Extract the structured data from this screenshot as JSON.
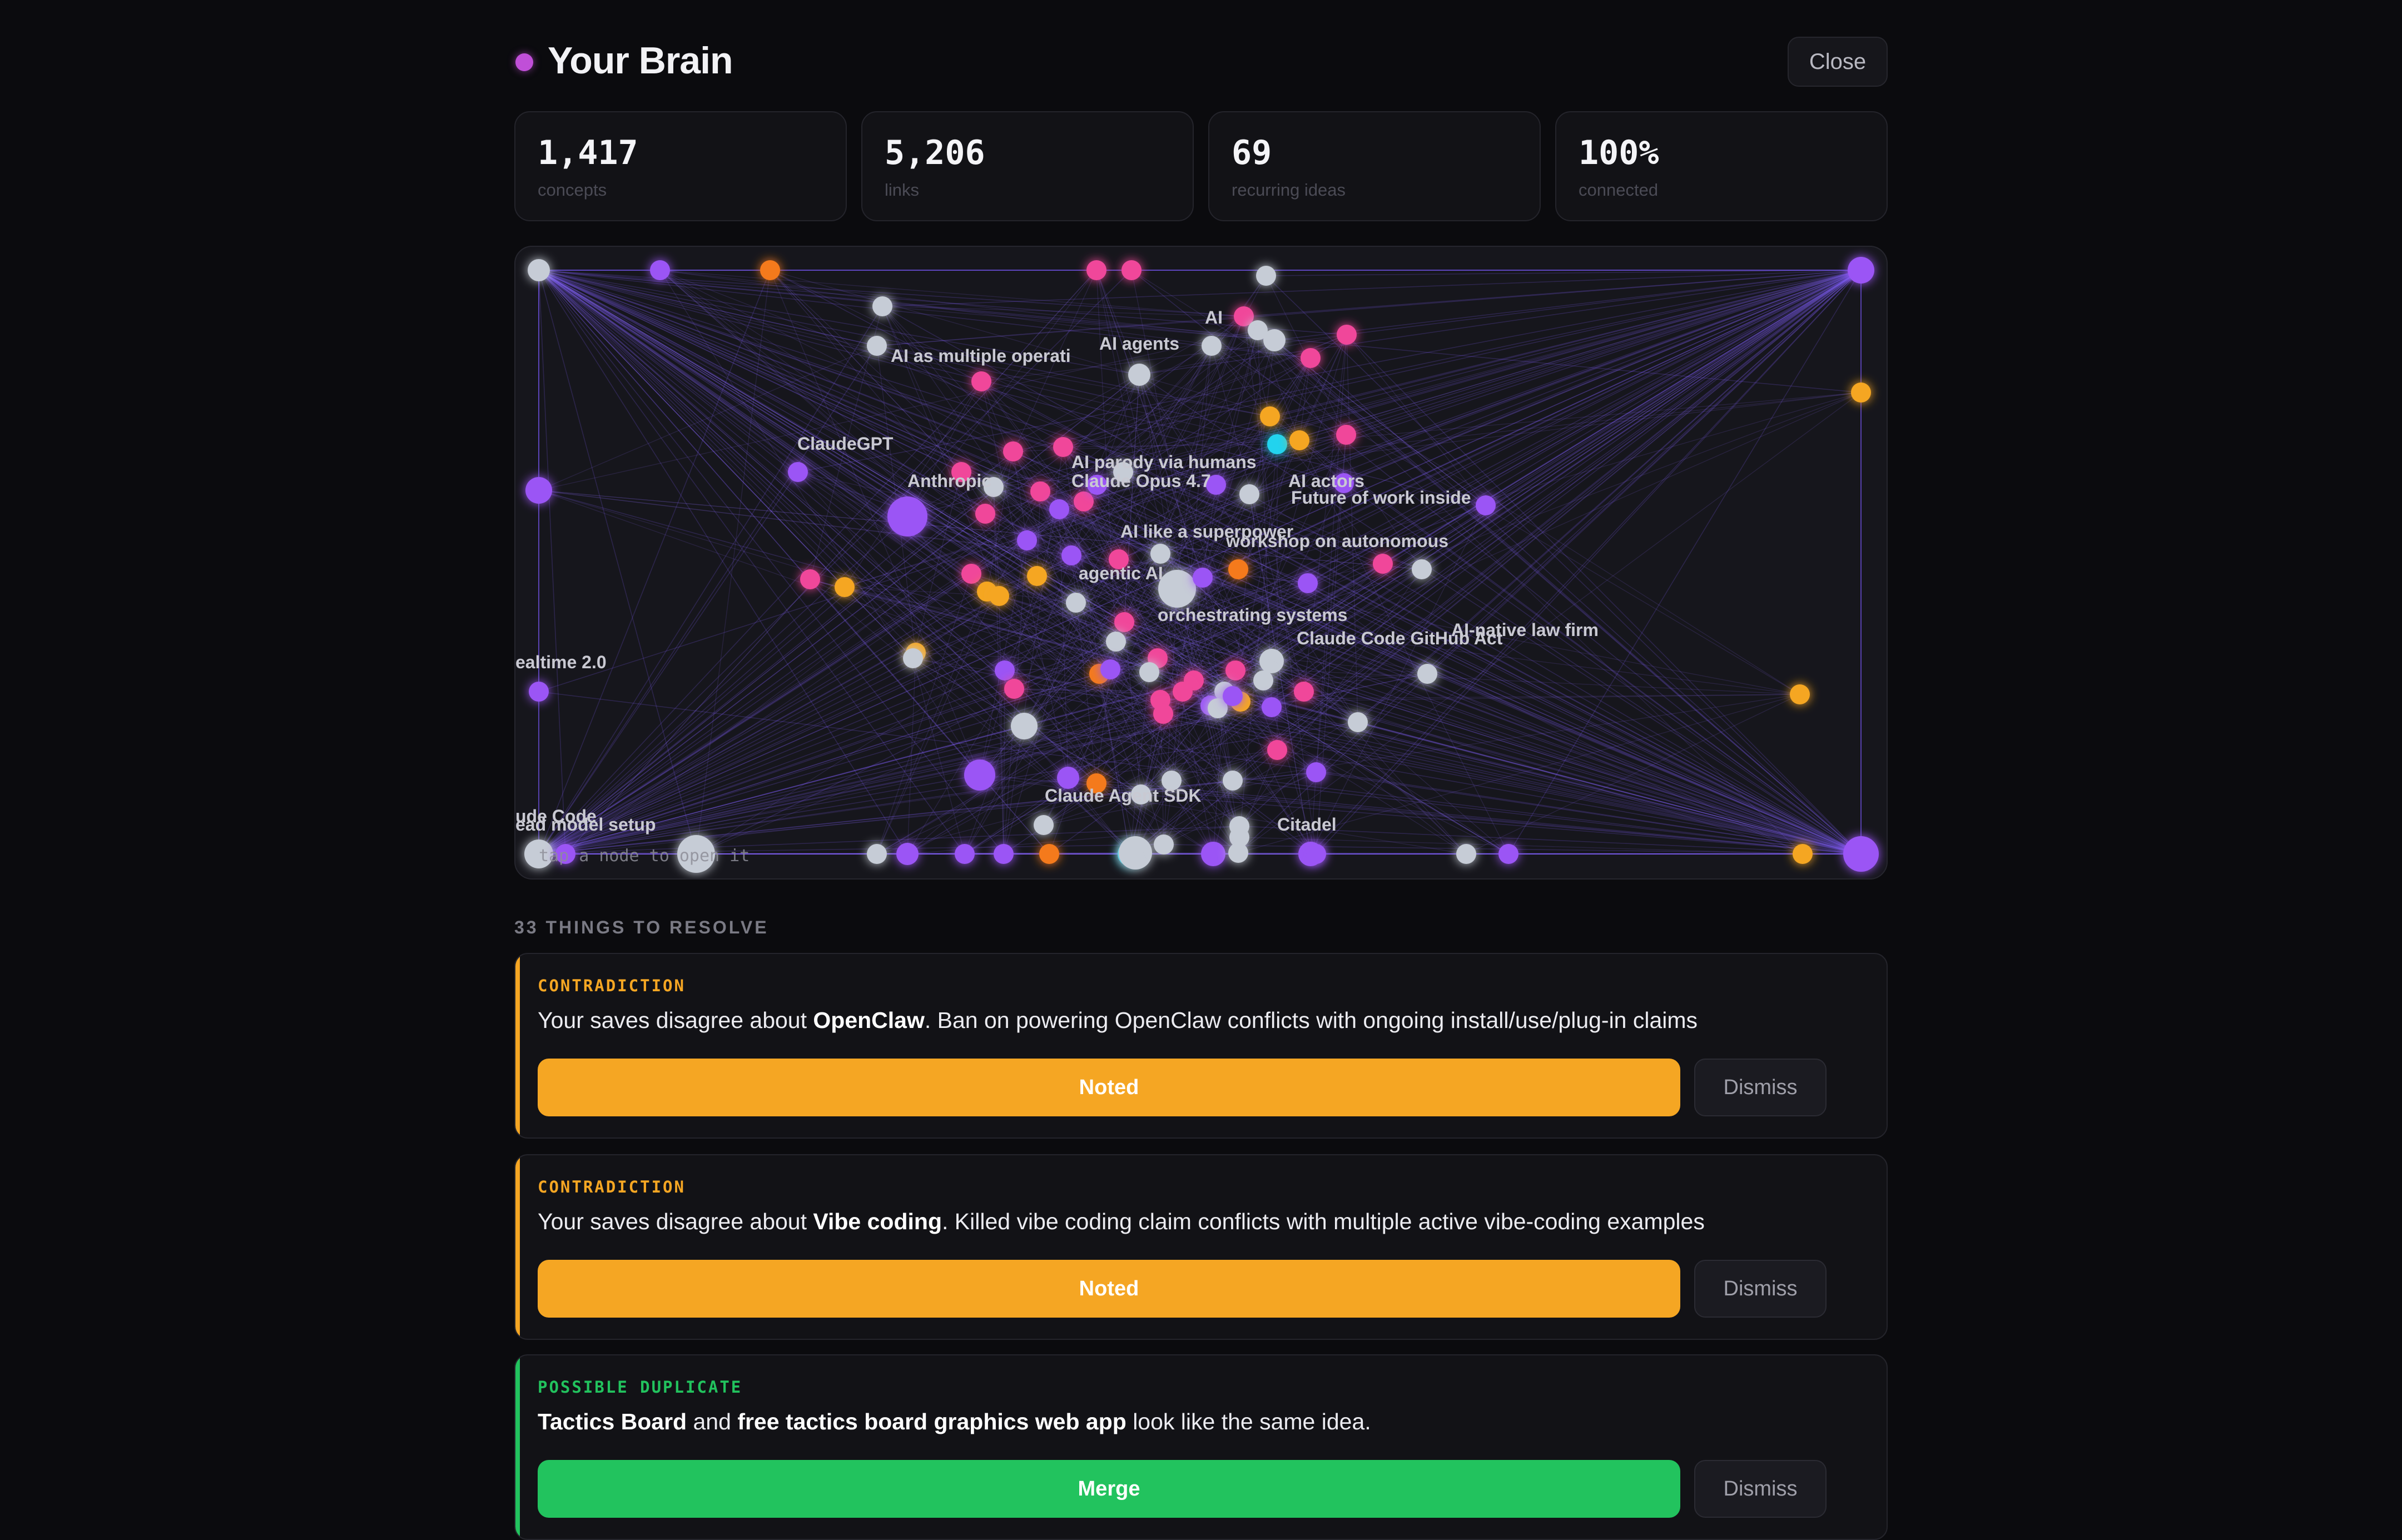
{
  "header": {
    "title": "Your Brain",
    "close_label": "Close",
    "dot_color": "#c04fd8"
  },
  "stats": [
    {
      "value": "1,417",
      "label": "concepts"
    },
    {
      "value": "5,206",
      "label": "links"
    },
    {
      "value": "69",
      "label": "recurring ideas"
    },
    {
      "value": "100%",
      "label": "connected"
    }
  ],
  "graph": {
    "labels": [
      "AI",
      "AI as multiple operati",
      "AI agents",
      "ClaudeGPT",
      "Anthropic",
      "AI parody via humans",
      "Claude Opus 4.7",
      "AI actors",
      "Future of work inside",
      "AI like a superpower",
      "workshop on autonomous",
      "agentic AI",
      "orchestrating systems",
      "Claude Code GitHub Act",
      "AI-native law firm",
      "ealtime 2.0",
      "Claude Agent SDK",
      "Citadel",
      "ude Code",
      "ead model setup"
    ],
    "hint": "tap a node to open it",
    "node_colors": {
      "purple": "#9b55f5",
      "pink": "#f0479a",
      "orange": "#f47a1f",
      "amber": "#f5a623",
      "gray": "#c6ccd6",
      "cyan": "#22d3ee"
    }
  },
  "issues": {
    "title": "33 THINGS TO RESOLVE",
    "items": [
      {
        "type": "CONTRADICTION",
        "accent": "#f5a623",
        "pre": "Your saves disagree about ",
        "bold1": "OpenClaw",
        "post": ". Ban on powering OpenClaw conflicts with ongoing install/use/plug-in claims",
        "primary_label": "Noted",
        "dismiss_label": "Dismiss"
      },
      {
        "type": "CONTRADICTION",
        "accent": "#f5a623",
        "pre": "Your saves disagree about ",
        "bold1": "Vibe coding",
        "post": ". Killed vibe coding claim conflicts with multiple active vibe-coding examples",
        "primary_label": "Noted",
        "dismiss_label": "Dismiss"
      },
      {
        "type": "POSSIBLE DUPLICATE",
        "accent": "#22c35e",
        "bold1": "Tactics Board",
        "mid": " and ",
        "bold2": "free tactics board graphics web app",
        "post": " look like the same idea.",
        "primary_label": "Merge",
        "dismiss_label": "Dismiss"
      }
    ]
  }
}
